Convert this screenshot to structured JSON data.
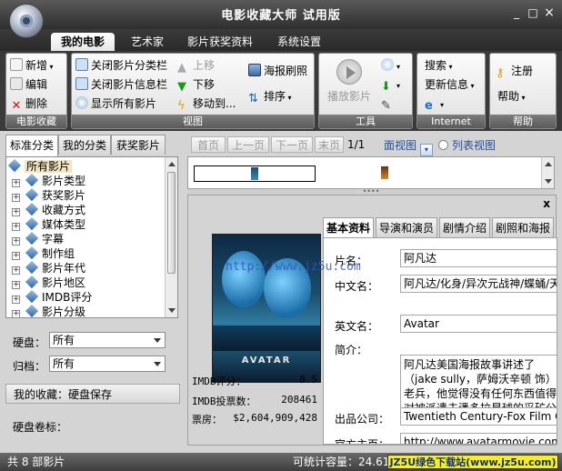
{
  "window": {
    "title": "电影收藏大师  试用版",
    "minimize": "_",
    "maximize": "□",
    "close": "×"
  },
  "tabs": [
    "我的电影",
    "艺术家",
    "影片获奖资料",
    "系统设置"
  ],
  "ribbon": {
    "groups": {
      "collection": "电影收藏",
      "view": "视图",
      "tools": "工具",
      "internet": "Internet",
      "help": "帮助"
    },
    "collection": {
      "add": "新增",
      "edit": "编辑",
      "delete": "删除"
    },
    "view": {
      "close_category": "关闭影片分类栏",
      "close_info": "关闭影片信息栏",
      "show_all": "显示所有影片",
      "move_up": "上移",
      "move_down": "下移",
      "move_to": "移动到...",
      "poster_refresh": "海报刷照",
      "sort": "排序"
    },
    "tools": {
      "play": "播放影片"
    },
    "internet": {
      "search": "搜索",
      "update_info": "更新信息"
    },
    "help": {
      "register": "注册",
      "help": "帮助"
    }
  },
  "left": {
    "tabs": [
      "标准分类",
      "我的分类",
      "获奖影片"
    ],
    "tree": {
      "root": "所有影片",
      "items": [
        "影片类型",
        "获奖影片",
        "收藏方式",
        "媒体类型",
        "字幕",
        "制作组",
        "影片年代",
        "影片地区",
        "IMDB评分",
        "影片分级"
      ]
    },
    "disk_label": "硬盘：",
    "disk_value": "所有",
    "archive_label": "归档：",
    "archive_value": "所有",
    "my_collection": "我的收藏：硬盘保存",
    "disk_volume_label": "硬盘卷标："
  },
  "pager": {
    "first": "首页",
    "prev": "上一页",
    "next": "下一页",
    "last": "末页",
    "page": "1/1",
    "view_face": "面视图",
    "view_list": "列表视图"
  },
  "detail": {
    "close": "x",
    "poster_title": "AVATAR",
    "imdb_score_label": "IMDB评分：",
    "imdb_score": "8.5",
    "imdb_votes_label": "IMDB投票数：",
    "imdb_votes": "208461",
    "box_office_label": "票房：",
    "box_office": "$2,604,909,428",
    "tabs": [
      "基本资料",
      "导演和演员",
      "剧情介绍",
      "剧照和海报"
    ],
    "fields": {
      "name_label": "片名：",
      "name": "阿凡达",
      "cn_name_label": "中文名：",
      "cn_name": "阿凡达/化身/异次元战神/蝶蛹/天",
      "en_name_label": "英文名：",
      "en_name": "Avatar",
      "summary_label": "简介：",
      "summary": "      阿凡达美国海报故事讲述了（jake sully，萨姆沃辛顿 饰）老兵，他觉得没有任何东西值得对被派遣去潘多拉星球的采矿公",
      "company_label": "出品公司：",
      "company": "Twentieth Century-Fox Film Cor",
      "homepage_label": "官方主页：",
      "homepage": "http://www.avatarmovie.com/"
    }
  },
  "status": {
    "count": "共 8 部影片",
    "capacity": "可统计容量：24.61",
    "watermark": "JZ5U绿色下载站(www.jz5u.com)",
    "mid_watermark": "http://www.jz5u.com"
  },
  "colors": {
    "accent": "#1f4fa0",
    "titlebar": "#3a3a3a",
    "badge": "#fff200"
  }
}
